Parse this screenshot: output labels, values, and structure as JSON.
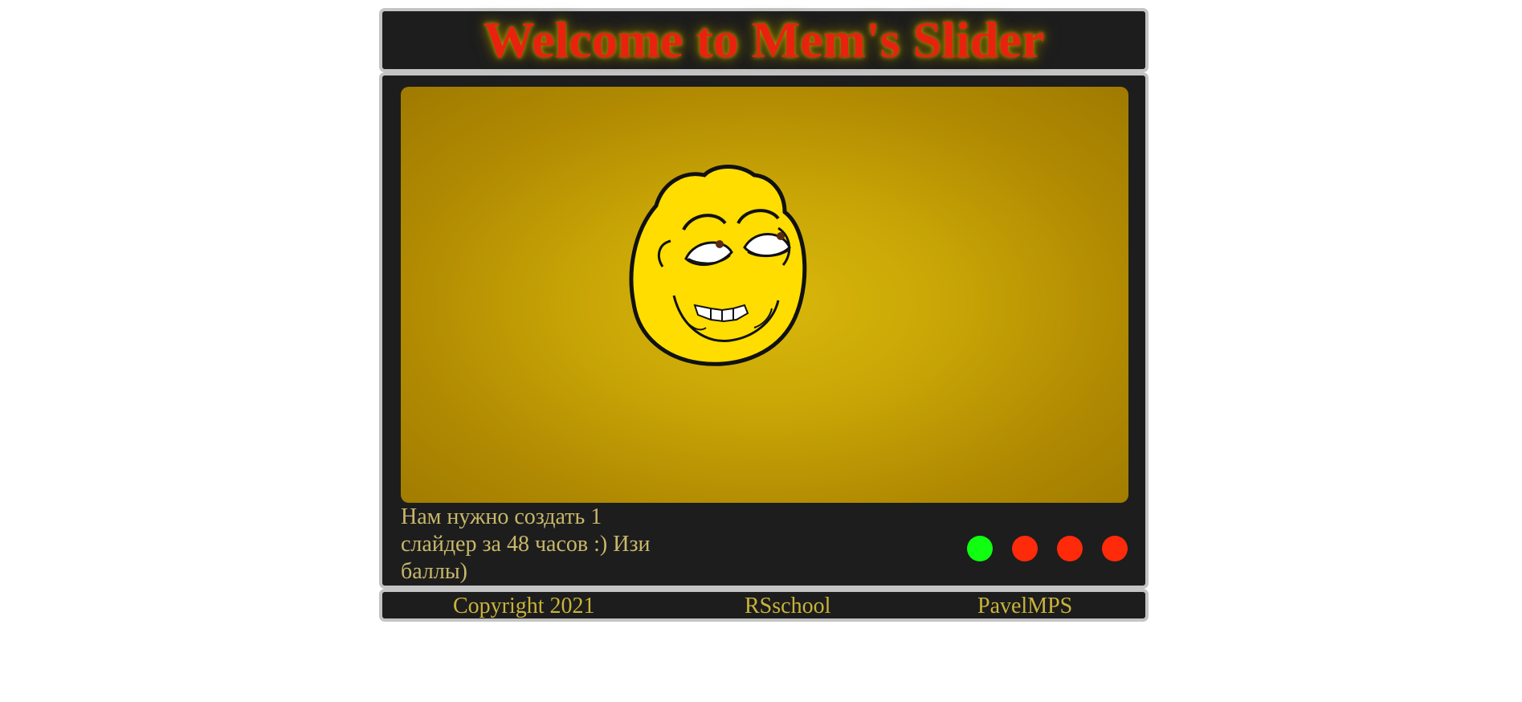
{
  "header": {
    "title": "Welcome to Mem's Slider"
  },
  "slider": {
    "caption": "Нам нужно создать 1 слайдер за 48 часов :) Изи баллы)",
    "image": "yellow-smug-meme-face",
    "dots": [
      {
        "state": "active",
        "color": "#10ff10"
      },
      {
        "state": "inactive",
        "color": "#ff2a0a"
      },
      {
        "state": "inactive",
        "color": "#ff2a0a"
      },
      {
        "state": "inactive",
        "color": "#ff2a0a"
      }
    ]
  },
  "footer": {
    "copyright": "Copyright 2021",
    "school": "RSschool",
    "author": "PavelMPS"
  }
}
